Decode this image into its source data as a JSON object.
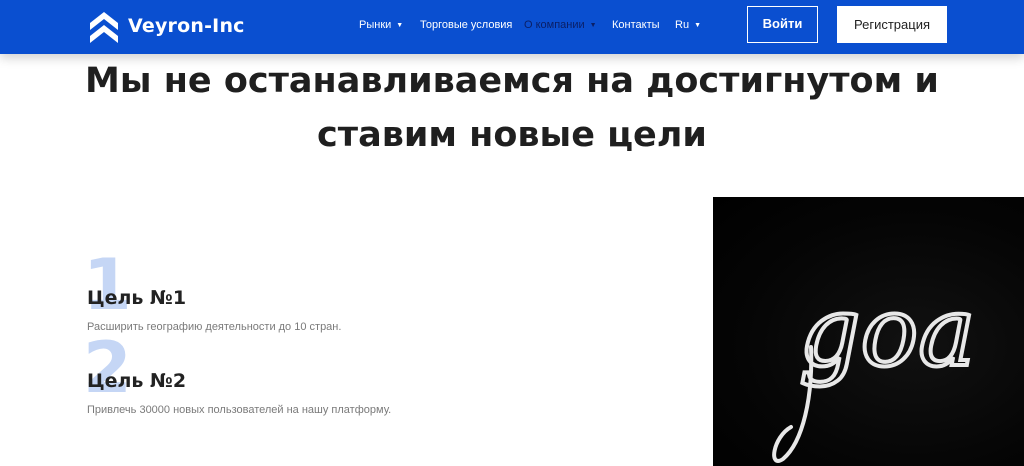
{
  "header": {
    "brand": "Veyron-Inc",
    "nav": [
      {
        "label": "Рынки",
        "has_dropdown": true
      },
      {
        "label": "Торговые условия",
        "has_dropdown": false
      },
      {
        "label": "О компании",
        "has_dropdown": true
      },
      {
        "label": "Контакты",
        "has_dropdown": false
      },
      {
        "label": "Ru",
        "has_dropdown": true
      }
    ],
    "login_label": "Войти",
    "register_label": "Регистрация"
  },
  "hero": {
    "headline_line1": "Мы не останавливаемся на достигнутом и",
    "headline_line2": "ставим новые цели"
  },
  "goals": [
    {
      "number": "1",
      "title": "Цель №1",
      "description": "Расширить географию деятельности до 10 стран."
    },
    {
      "number": "2",
      "title": "Цель №2",
      "description": "Привлечь 30000 новых пользователей на нашу платформу."
    }
  ],
  "photo": {
    "chalk_text": "goa"
  },
  "colors": {
    "brand_blue": "#0a4fd0",
    "active_nav": "#0a1f66",
    "goal_number": "#c5d6f5"
  }
}
